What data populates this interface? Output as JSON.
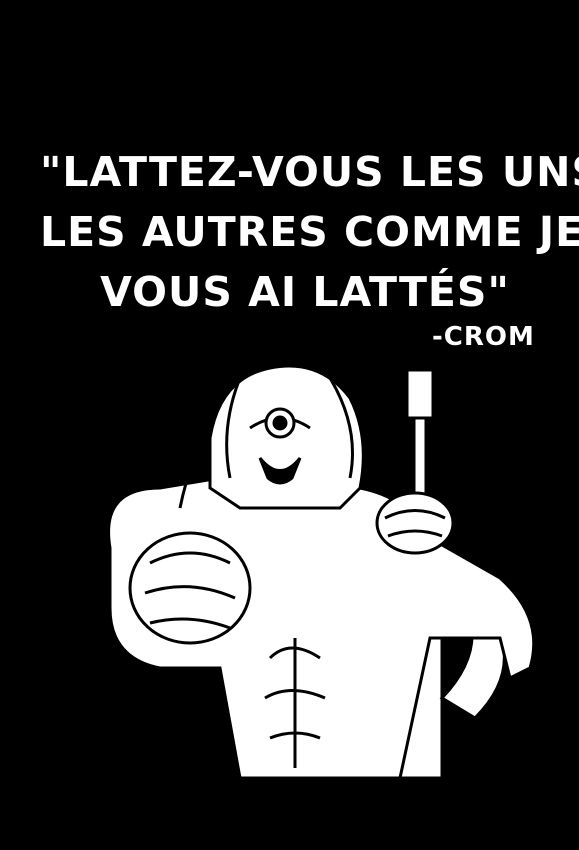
{
  "quote": {
    "lines": [
      "\"LATTEZ-VOUS LES UNS",
      "LES AUTRES COMME JE",
      "VOUS AI LATTÉS\""
    ],
    "attribution": "-CROM"
  },
  "colors": {
    "background": "#000000",
    "ink": "#ffffff"
  }
}
